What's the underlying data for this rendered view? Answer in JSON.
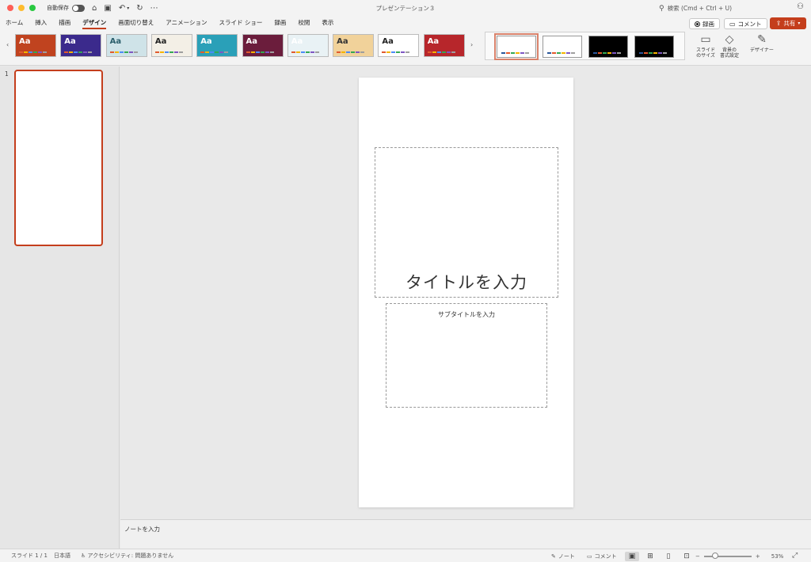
{
  "titlebar": {
    "autosave_label": "自動保存",
    "document_title": "プレゼンテーション３",
    "search_placeholder": "検索 (Cmd + Ctrl + U)",
    "more": "⋯"
  },
  "tabs": [
    {
      "label": "ホーム",
      "active": false
    },
    {
      "label": "挿入",
      "active": false
    },
    {
      "label": "描画",
      "active": false
    },
    {
      "label": "デザイン",
      "active": true
    },
    {
      "label": "画面切り替え",
      "active": false
    },
    {
      "label": "アニメーション",
      "active": false
    },
    {
      "label": "スライド ショー",
      "active": false
    },
    {
      "label": "録画",
      "active": false
    },
    {
      "label": "校閲",
      "active": false
    },
    {
      "label": "表示",
      "active": false
    }
  ],
  "actions": {
    "record_label": "録画",
    "comment_label": "コメント",
    "share_label": "共有"
  },
  "ribbon": {
    "theme_glyph": "Aa",
    "themes": [
      {
        "bg": "#c0431f",
        "fg": "#ffffff"
      },
      {
        "bg": "#3b2a8c",
        "fg": "#ffffff"
      },
      {
        "bg": "#cfe3e8",
        "fg": "#2b5e6b"
      },
      {
        "bg": "#f3efe6",
        "fg": "#222222"
      },
      {
        "bg": "#2aa0b8",
        "fg": "#ffffff"
      },
      {
        "bg": "#6b1d3c",
        "fg": "#ffffff"
      },
      {
        "bg": "#e9f2f5",
        "fg": "#ffffff"
      },
      {
        "bg": "#f1d29a",
        "fg": "#333333"
      },
      {
        "bg": "#ffffff",
        "fg": "#222222"
      },
      {
        "bg": "#b7262b",
        "fg": "#ffffff"
      }
    ],
    "variants": [
      {
        "bg": "#ffffff"
      },
      {
        "bg": "#ffffff"
      },
      {
        "bg": "#000000"
      },
      {
        "bg": "#000000"
      }
    ],
    "slide_size_label": "スライド\nのサイズ",
    "format_bg_label": "背景の\n書式設定",
    "designer_label": "デザイナー"
  },
  "thumbnails": {
    "slide_number": "1"
  },
  "slide": {
    "title_placeholder": "タイトルを入力",
    "subtitle_placeholder": "サブタイトルを入力"
  },
  "notes": {
    "placeholder": "ノートを入力"
  },
  "statusbar": {
    "slide_info": "スライド 1 / 1",
    "language": "日本語",
    "accessibility": "アクセシビリティ: 問題ありません",
    "notes_label": "ノート",
    "comments_label": "コメント",
    "zoom_minus": "−",
    "zoom_plus": "+",
    "zoom_percent": "53%",
    "zoom_value": 53
  },
  "colors": {
    "accent": "#c43e1c"
  }
}
